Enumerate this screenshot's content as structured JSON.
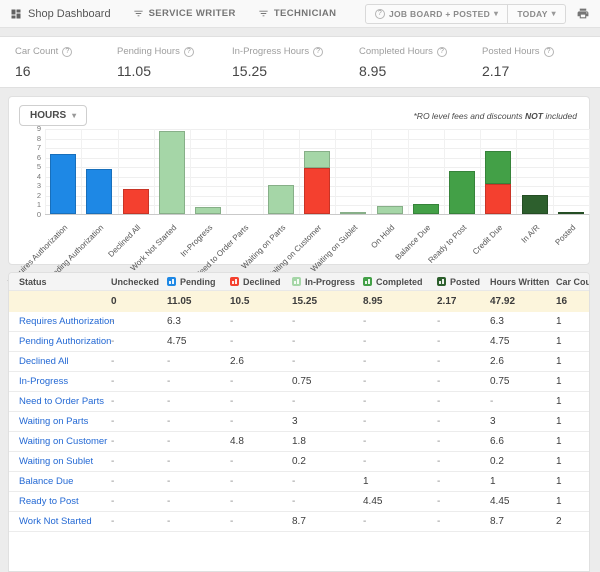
{
  "topbar": {
    "brand": "Shop Dashboard",
    "tabs": [
      {
        "label": "SERVICE WRITER"
      },
      {
        "label": "TECHNICIAN"
      }
    ],
    "view_button": "JOB BOARD + POSTED",
    "range_button": "TODAY",
    "help_glyph": "?"
  },
  "stats": [
    {
      "label": "Car Count",
      "value": "16"
    },
    {
      "label": "Pending Hours",
      "value": "11.05"
    },
    {
      "label": "In-Progress Hours",
      "value": "15.25"
    },
    {
      "label": "Completed Hours",
      "value": "8.95"
    },
    {
      "label": "Posted Hours",
      "value": "2.17"
    }
  ],
  "chart": {
    "unit_button": "HOURS",
    "note_prefix": "*RO level fees and discounts ",
    "note_bold": "NOT",
    "note_suffix": " included"
  },
  "chart_data": {
    "type": "bar",
    "stacked": true,
    "title": "",
    "xlabel": "",
    "ylabel": "",
    "ylim": [
      0,
      9
    ],
    "yticks": [
      0,
      1,
      2,
      3,
      4,
      5,
      6,
      7,
      8,
      9
    ],
    "grid": true,
    "legend_position": "none",
    "categories": [
      "Requires Authorization",
      "Pending Authorization",
      "Declined All",
      "Work Not Started",
      "In-Progress",
      "Need to Order Parts",
      "Waiting on Parts",
      "Waiting on Customer",
      "Waiting on Sublet",
      "On Hold",
      "Balance Due",
      "Ready to Post",
      "Credit Due",
      "In A/R",
      "Posted"
    ],
    "series": [
      {
        "name": "Pending",
        "color": "#1e88e5",
        "values": [
          6.3,
          4.75,
          0,
          0,
          0,
          0,
          0,
          0,
          0,
          0,
          0,
          0,
          0,
          0,
          0
        ]
      },
      {
        "name": "Declined",
        "color": "#f4402f",
        "values": [
          0,
          0,
          2.6,
          0,
          0,
          0,
          0,
          4.8,
          0,
          0,
          0,
          0,
          3.1,
          0,
          0
        ]
      },
      {
        "name": "In-Progress",
        "color": "#a5d6a7",
        "values": [
          0,
          0,
          0,
          8.7,
          0.75,
          0,
          3,
          1.8,
          0.2,
          0.8,
          0,
          0,
          0,
          0,
          0
        ]
      },
      {
        "name": "Completed",
        "color": "#43a047",
        "values": [
          0,
          0,
          0,
          0,
          0,
          0,
          0,
          0,
          0,
          0,
          1,
          4.45,
          3.5,
          0,
          0
        ]
      },
      {
        "name": "Posted",
        "color": "#2d5f2d",
        "values": [
          0,
          0,
          0,
          0,
          0,
          0,
          0,
          0,
          0,
          0,
          0,
          0,
          0,
          2,
          0.17
        ]
      }
    ]
  },
  "table": {
    "columns": [
      {
        "label": "Status"
      },
      {
        "label": "Unchecked"
      },
      {
        "label": "Pending",
        "chip": "#1e88e5"
      },
      {
        "label": "Declined",
        "chip": "#f4402f"
      },
      {
        "label": "In-Progress",
        "chip": "#a5d6a7"
      },
      {
        "label": "Completed",
        "chip": "#43a047"
      },
      {
        "label": "Posted",
        "chip": "#2d5f2d"
      },
      {
        "label": "Hours Written"
      },
      {
        "label": "Car Count"
      }
    ],
    "totals": [
      "",
      "0",
      "11.05",
      "10.5",
      "15.25",
      "8.95",
      "2.17",
      "47.92",
      "16"
    ],
    "rows": [
      {
        "status": "Requires Authorization",
        "cells": [
          "-",
          "6.3",
          "-",
          "-",
          "-",
          "-",
          "6.3",
          "1"
        ]
      },
      {
        "status": "Pending Authorization",
        "cells": [
          "-",
          "4.75",
          "-",
          "-",
          "-",
          "-",
          "4.75",
          "1"
        ]
      },
      {
        "status": "Declined All",
        "cells": [
          "-",
          "-",
          "2.6",
          "-",
          "-",
          "-",
          "2.6",
          "1"
        ]
      },
      {
        "status": "In-Progress",
        "cells": [
          "-",
          "-",
          "-",
          "0.75",
          "-",
          "-",
          "0.75",
          "1"
        ]
      },
      {
        "status": "Need to Order Parts",
        "cells": [
          "-",
          "-",
          "-",
          "-",
          "-",
          "-",
          "-",
          "1"
        ]
      },
      {
        "status": "Waiting on Parts",
        "cells": [
          "-",
          "-",
          "-",
          "3",
          "-",
          "-",
          "3",
          "1"
        ]
      },
      {
        "status": "Waiting on Customer",
        "cells": [
          "-",
          "-",
          "4.8",
          "1.8",
          "-",
          "-",
          "6.6",
          "1"
        ]
      },
      {
        "status": "Waiting on Sublet",
        "cells": [
          "-",
          "-",
          "-",
          "0.2",
          "-",
          "-",
          "0.2",
          "1"
        ]
      },
      {
        "status": "Balance Due",
        "cells": [
          "-",
          "-",
          "-",
          "-",
          "1",
          "-",
          "1",
          "1"
        ]
      },
      {
        "status": "Ready to Post",
        "cells": [
          "-",
          "-",
          "-",
          "-",
          "4.45",
          "-",
          "4.45",
          "1"
        ]
      },
      {
        "status": "Work Not Started",
        "cells": [
          "-",
          "-",
          "-",
          "8.7",
          "-",
          "-",
          "8.7",
          "2"
        ]
      }
    ]
  }
}
